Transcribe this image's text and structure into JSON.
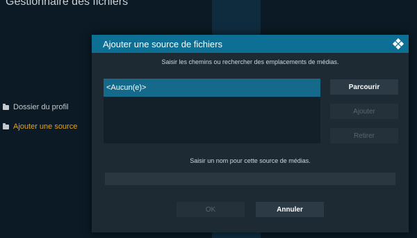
{
  "page": {
    "title": "Gestionnaire des fichiers",
    "sidebar": [
      {
        "label": "Dossier du profil",
        "active": false
      },
      {
        "label": "Ajouter une source",
        "active": true
      }
    ]
  },
  "dialog": {
    "title": "Ajouter une source de fichiers",
    "paths_instruction": "Saisir les chemins ou rechercher des emplacements de médias.",
    "paths": [
      "<Aucun(e)>"
    ],
    "buttons": {
      "browse": "Parcourir",
      "add": "Ajouter",
      "remove": "Retirer",
      "ok": "OK",
      "cancel": "Annuler"
    },
    "name_instruction": "Saisir un nom pour cette source de médias.",
    "name_value": ""
  },
  "colors": {
    "header": "#0d6f94",
    "selected_row": "#156a8c",
    "active_sidebar": "#e6a21a"
  }
}
